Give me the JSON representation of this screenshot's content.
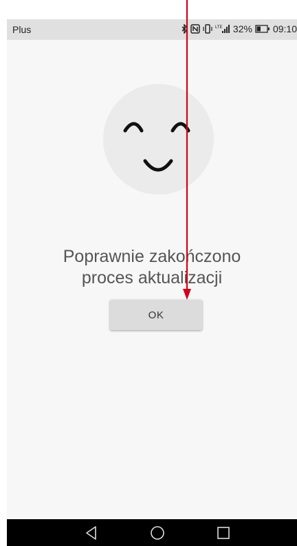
{
  "status_bar": {
    "carrier": "Plus",
    "network": "LTE",
    "battery_percent": "32%",
    "time": "09:10",
    "icons": [
      "bluetooth-icon",
      "nfc-icon",
      "vibrate-icon",
      "signal-icon",
      "battery-icon"
    ]
  },
  "dialog": {
    "illustration": "smiley-face-icon",
    "message_line1": "Poprawnie zakończono",
    "message_line2": "proces aktualizacji",
    "ok_label": "OK"
  },
  "navigation": {
    "back": "back-icon",
    "home": "home-icon",
    "recents": "recents-icon"
  },
  "colors": {
    "status_bar_bg": "#e0e0e0",
    "background": "#f7f7f7",
    "circle_bg": "#ebebeb",
    "text": "#555555",
    "button_bg": "#dcdcdc",
    "annotation_arrow": "#d0021b",
    "nav_bar_bg": "#000000"
  }
}
